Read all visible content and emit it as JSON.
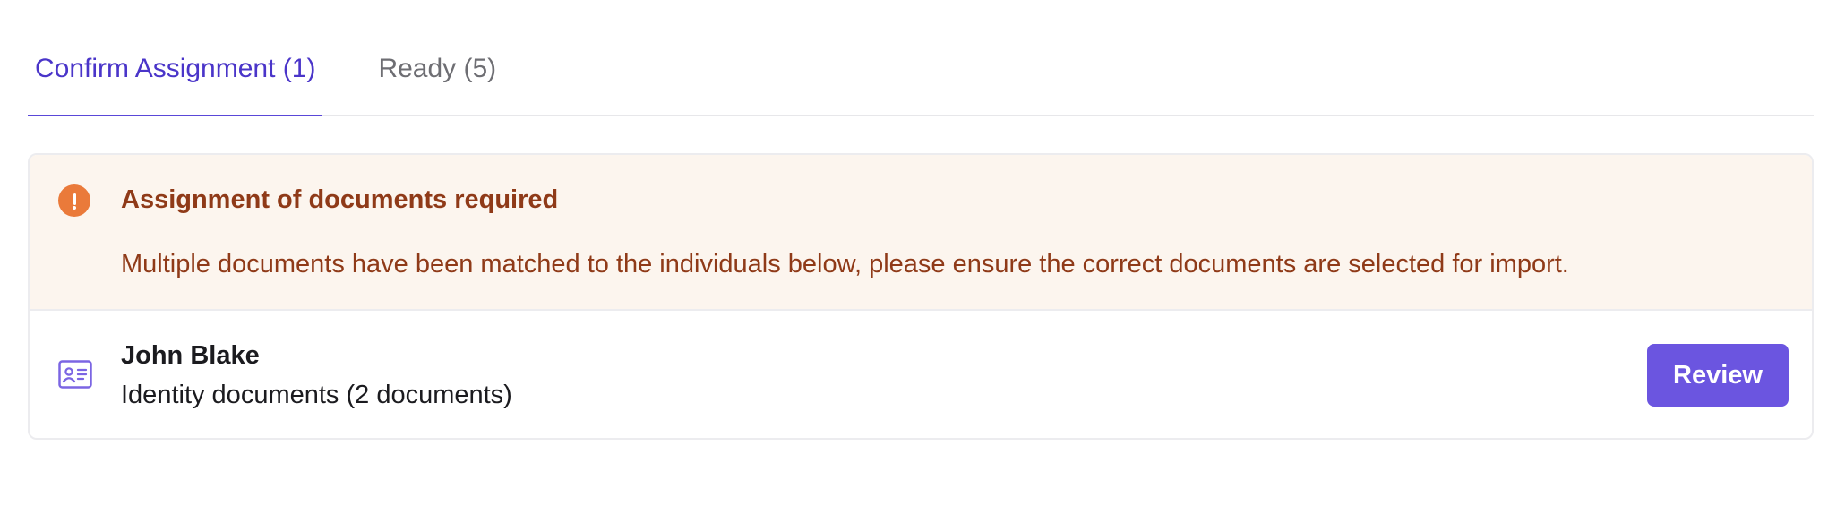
{
  "tabs": [
    {
      "label": "Confirm Assignment (1)",
      "active": true
    },
    {
      "label": "Ready (5)",
      "active": false
    }
  ],
  "alert": {
    "icon": "exclamation-circle-icon",
    "title": "Assignment of documents required",
    "message": "Multiple documents have been matched to the individuals below, please ensure the correct documents are selected for import."
  },
  "items": [
    {
      "icon": "id-card-icon",
      "name": "John Blake",
      "documents": "Identity documents (2 documents)",
      "action_label": "Review"
    }
  ],
  "colors": {
    "accent": "#5a47d8",
    "button": "#6b55e0",
    "alert_background": "#fcf5ee",
    "alert_text": "#8f3a18",
    "alert_icon": "#ea7a3a"
  }
}
